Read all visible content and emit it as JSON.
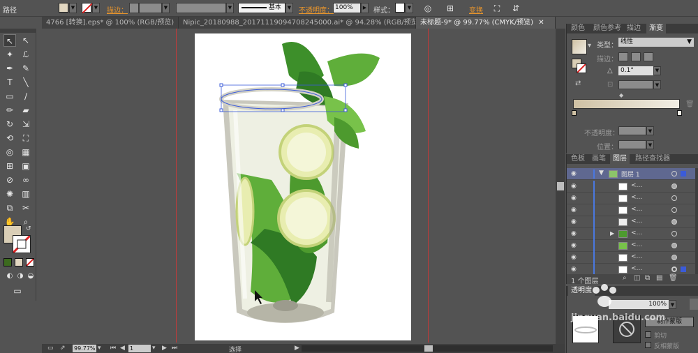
{
  "control_bar": {
    "object_type": "路径",
    "stroke_label": "描边：",
    "stroke_style": "基本",
    "opacity_label": "不透明度：",
    "opacity_value": "100%",
    "style_label": "样式：",
    "transform_label": "变换"
  },
  "doc_tabs": [
    {
      "label": "4766 [转换].eps* @ 100% (RGB/预览)"
    },
    {
      "label": "Nipic_20180988_20171119094708245000.ai* @ 94.28% (RGB/预览)"
    },
    {
      "label": "未标题-9* @ 99.77% (CMYK/预览)"
    }
  ],
  "tools": {
    "selection": "↖",
    "direct_selection": "↖",
    "magic_wand": "✦",
    "lasso": "ℒ",
    "pen": "✒",
    "curvature": "✎",
    "type": "T",
    "line": "╲",
    "rectangle": "▭",
    "brush": "∕",
    "pencil": "✏",
    "eraser": "▰",
    "rotate": "↻",
    "scale": "⇲",
    "warp": "⟲",
    "free_transform": "⛶",
    "shape_builder": "◎",
    "chart": "▦",
    "mesh": "⊞",
    "gradient": "▣",
    "eyedropper": "⊘",
    "blend": "∞",
    "symbol_sprayer": "✺",
    "graph": "▥",
    "artboard": "⧉",
    "slice": "✂",
    "hand": "✋",
    "zoom": "⌕"
  },
  "status": {
    "zoom": "99.77%",
    "page": "1",
    "tool": "选择"
  },
  "gradient_panel": {
    "tabs": [
      "颜色",
      "颜色参考",
      "描边",
      "渐变"
    ],
    "type_label": "类型：",
    "type_value": "线性",
    "stroke_label": "描边：",
    "angle_label": "△",
    "angle_value": "0.1°",
    "opacity_label": "不透明度：",
    "location_label": "位置："
  },
  "layers_panel": {
    "tabs": [
      "色板",
      "画笔",
      "图层",
      "路径查找器"
    ],
    "layer_name": "图层 1",
    "sublayer_label": "<...",
    "count": "1 个图层"
  },
  "transparency_panel": {
    "tab": "透明度",
    "opacity_value": "100%",
    "mask_button": "制作蒙版",
    "clip_label": "剪切",
    "invert_label": "反相蒙版"
  },
  "colors": {
    "mint_dark": "#2f7a24",
    "mint_light": "#78c24a",
    "lime_yellow": "#e8edb0",
    "glass_gray": "#c9c8bd",
    "selection_blue": "#3b5bd9"
  },
  "watermark": {
    "text": "jingyan.baidu.com"
  }
}
